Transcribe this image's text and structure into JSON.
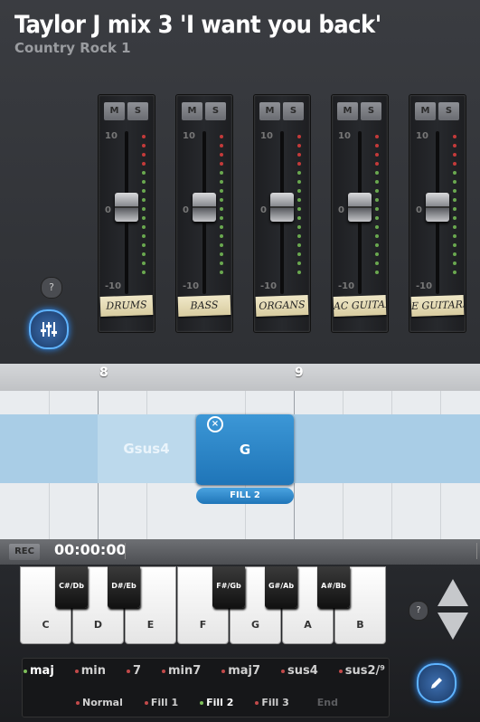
{
  "header": {
    "title": "Taylor J mix 3 'I want you back'",
    "subtitle": "Country Rock 1"
  },
  "mixer": {
    "mute_label": "M",
    "solo_label": "S",
    "tick_top": "10",
    "tick_mid": "0",
    "tick_bottom": "-10",
    "channels": [
      {
        "name": "DRUMS"
      },
      {
        "name": "BASS"
      },
      {
        "name": "ORGANS"
      },
      {
        "name": "AC GUITAR"
      },
      {
        "name": "E GUITARS"
      }
    ],
    "help_label": "?"
  },
  "timeline": {
    "bars": [
      "8",
      "9"
    ],
    "chords": [
      "Gsus4",
      "G"
    ],
    "selected_chord": "G",
    "fill_label": "FILL 2"
  },
  "transport": {
    "rec_label": "REC",
    "time": "00:00:00"
  },
  "keyboard": {
    "white_keys": [
      "C",
      "D",
      "E",
      "F",
      "G",
      "A",
      "B"
    ],
    "black_keys": [
      "C#/Db",
      "D#/Eb",
      "F#/Gb",
      "G#/Ab",
      "A#/Bb"
    ],
    "help_label": "?"
  },
  "chord_types": {
    "items": [
      "maj",
      "min",
      "7",
      "min7",
      "maj7",
      "sus4",
      "sus2/⁹"
    ],
    "selected": "maj"
  },
  "fills": {
    "items": [
      "Normal",
      "Fill 1",
      "Fill 2",
      "Fill 3",
      "End"
    ],
    "selected": "Fill 2",
    "disabled": "End"
  },
  "colors": {
    "accent": "#2c8fff",
    "chord_selected": "#1f75b8",
    "active_dot": "#7ec05a",
    "inactive_dot": "#c24a4a"
  }
}
